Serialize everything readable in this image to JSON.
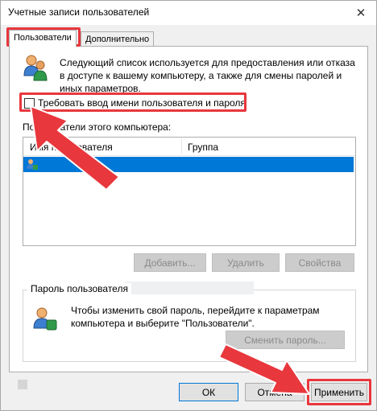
{
  "window": {
    "title": "Учетные записи пользователей"
  },
  "tabs": [
    {
      "label": "Пользователи"
    },
    {
      "label": "Дополнительно"
    }
  ],
  "intro": {
    "text": "Следующий список используется для предоставления или отказа в доступе к вашему компьютеру, а также для смены паролей и иных параметров."
  },
  "require_login": {
    "label": "Требовать ввод имени пользователя и пароля",
    "checked": false
  },
  "users_list": {
    "label": "Пользователи этого компьютера:",
    "columns": [
      "Имя пользователя",
      "Группа"
    ]
  },
  "user_buttons": {
    "add": "Добавить...",
    "remove": "Удалить",
    "properties": "Свойства"
  },
  "password_group": {
    "title": "Пароль пользователя",
    "text": "Чтобы изменить свой пароль, перейдите к параметрам компьютера и выберите \"Пользователи\".",
    "button": "Сменить пароль..."
  },
  "footer": {
    "ok": "ОК",
    "cancel": "Отмена",
    "apply": "Применить"
  },
  "colors": {
    "highlight": "#e8373d",
    "selection": "#0078d7",
    "arrow": "#e8373d"
  }
}
